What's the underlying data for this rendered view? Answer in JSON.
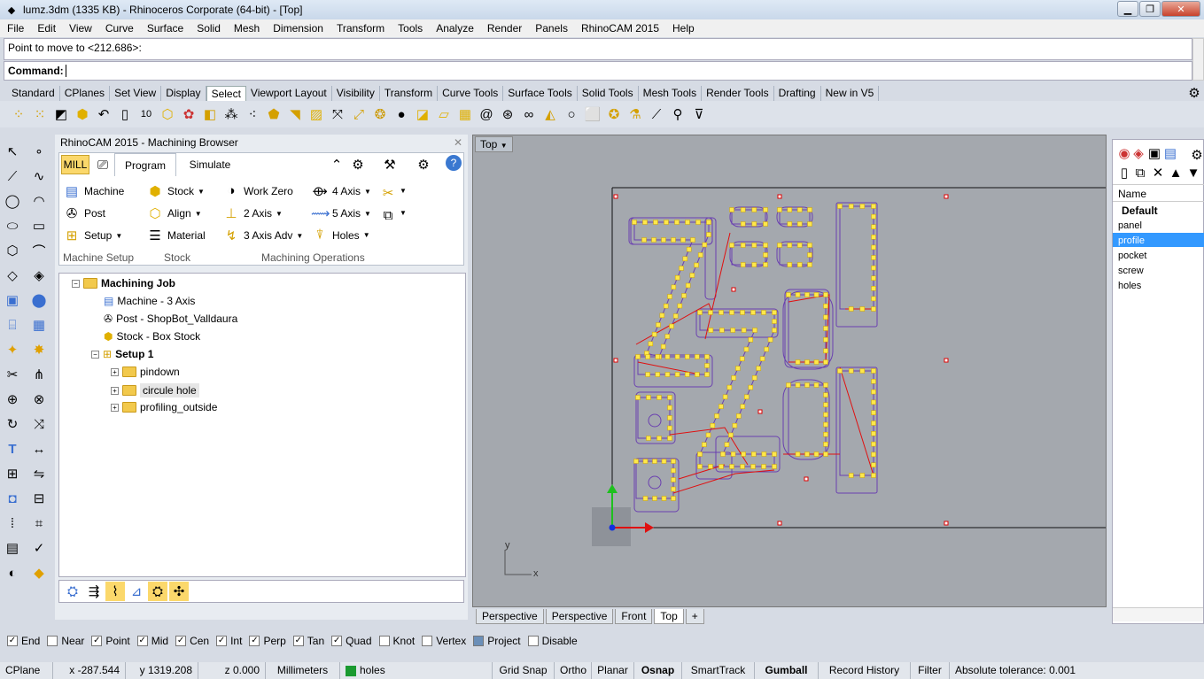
{
  "title": "lumz.3dm (1335 KB) - Rhinoceros Corporate (64-bit) - [Top]",
  "menu": [
    "File",
    "Edit",
    "View",
    "Curve",
    "Surface",
    "Solid",
    "Mesh",
    "Dimension",
    "Transform",
    "Tools",
    "Analyze",
    "Render",
    "Panels",
    "RhinoCAM 2015",
    "Help"
  ],
  "command": {
    "history": "Point to move to <212.686>:",
    "prompt": "Command:"
  },
  "toolbar_tabs": [
    "Standard",
    "CPlanes",
    "Set View",
    "Display",
    "Select",
    "Viewport Layout",
    "Visibility",
    "Transform",
    "Curve Tools",
    "Surface Tools",
    "Solid Tools",
    "Mesh Tools",
    "Render Tools",
    "Drafting",
    "New in V5"
  ],
  "browser": {
    "title": "RhinoCAM 2015 - Machining Browser",
    "mode": "MILL",
    "tabs": [
      "Program",
      "Simulate"
    ],
    "ribbon": {
      "machine": "Machine",
      "post": "Post",
      "setup": "Setup",
      "stock": "Stock",
      "align": "Align",
      "material": "Material",
      "workzero": "Work Zero",
      "axis2": "2 Axis",
      "axis3": "3 Axis Adv",
      "axis4": "4 Axis",
      "axis5": "5 Axis",
      "holes": "Holes",
      "groups": [
        "Machine Setup",
        "Stock",
        "Machining Operations"
      ]
    },
    "tree": {
      "job": "Machining Job",
      "machine": "Machine - 3 Axis",
      "post": "Post - ShopBot_Valldaura",
      "stock": "Stock - Box Stock",
      "setup": "Setup 1",
      "items": [
        "pindown",
        "circule hole",
        "profiling_outside"
      ]
    }
  },
  "viewport": {
    "label": "Top",
    "axis_x": "x",
    "axis_y": "y",
    "tabs": [
      "Perspective",
      "Perspective",
      "Front",
      "Top",
      "+"
    ]
  },
  "layers": {
    "header": "Name",
    "items": [
      "Default",
      "panel",
      "profile",
      "pocket",
      "screw",
      "holes"
    ],
    "selected": "profile"
  },
  "osnap": [
    {
      "label": "End",
      "on": true
    },
    {
      "label": "Near",
      "on": false
    },
    {
      "label": "Point",
      "on": true
    },
    {
      "label": "Mid",
      "on": true
    },
    {
      "label": "Cen",
      "on": true
    },
    {
      "label": "Int",
      "on": true
    },
    {
      "label": "Perp",
      "on": true
    },
    {
      "label": "Tan",
      "on": true
    },
    {
      "label": "Quad",
      "on": true
    },
    {
      "label": "Knot",
      "on": false
    },
    {
      "label": "Vertex",
      "on": false
    },
    {
      "label": "Project",
      "on": false
    },
    {
      "label": "Disable",
      "on": false
    }
  ],
  "status": {
    "cplane": "CPlane",
    "x": "x -287.544",
    "y": "y 1319.208",
    "z": "z 0.000",
    "units": "Millimeters",
    "layer": "holes",
    "grid": "Grid Snap",
    "ortho": "Ortho",
    "planar": "Planar",
    "osnap": "Osnap",
    "smarttrack": "SmartTrack",
    "gumball": "Gumball",
    "history": "Record History",
    "filter": "Filter",
    "tolerance": "Absolute tolerance: 0.001"
  },
  "colors": {
    "profile_curve": "#6a3fb0",
    "toolpath": "#e01010",
    "point_fill": "#ffe84a",
    "viewport_bg": "#a4a8ae"
  }
}
